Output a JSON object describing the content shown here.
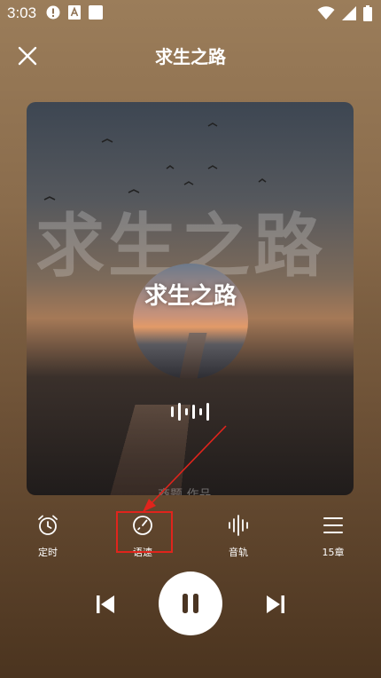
{
  "status_bar": {
    "time": "3:03",
    "left_icons": [
      "alert-icon",
      "a-notification-icon",
      "square-notification-icon"
    ],
    "right_icons": [
      "wifi-icon",
      "signal-icon",
      "battery-icon"
    ]
  },
  "header": {
    "title": "求生之路"
  },
  "cover": {
    "large_title": "求生之路",
    "disc_title": "求生之路",
    "author_text": "商题 作品"
  },
  "toolbar": {
    "items": [
      {
        "label": "定时",
        "icon": "alarm-clock-icon"
      },
      {
        "label": "语速",
        "icon": "speed-gauge-icon"
      },
      {
        "label": "音轨",
        "icon": "audio-track-icon"
      },
      {
        "label": "15章",
        "icon": "chapter-list-icon"
      }
    ]
  },
  "playback": {
    "state": "playing"
  },
  "colors": {
    "annotation": "#e0241c",
    "play_button": "#ffffff"
  }
}
